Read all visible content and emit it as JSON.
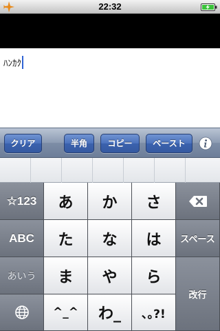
{
  "status_bar": {
    "time": "22:32",
    "airplane_icon": "airplane-icon",
    "battery_icon": "battery-charging-icon",
    "colors": {
      "airplane": "#e88a1a",
      "battery": "#3ac23a"
    }
  },
  "text_area": {
    "value": "ﾊﾝｶｸ"
  },
  "toolbar": {
    "clear_label": "クリア",
    "hankaku_label": "半角",
    "copy_label": "コピー",
    "paste_label": "ペースト",
    "info_icon": "info-icon",
    "accent_color": "#3b62ad"
  },
  "keyboard": {
    "left": {
      "symbols_label": "☆123",
      "abc_label": "ABC",
      "kana_label": "あいう",
      "globe_icon": "globe-icon"
    },
    "rows": [
      [
        "あ",
        "か",
        "さ"
      ],
      [
        "た",
        "な",
        "は"
      ],
      [
        "ま",
        "や",
        "ら"
      ],
      [
        "^_^",
        "わ_",
        "､｡?!"
      ]
    ],
    "right": {
      "delete_icon": "backspace-icon",
      "space_label": "スペース",
      "return_label": "改行"
    }
  }
}
